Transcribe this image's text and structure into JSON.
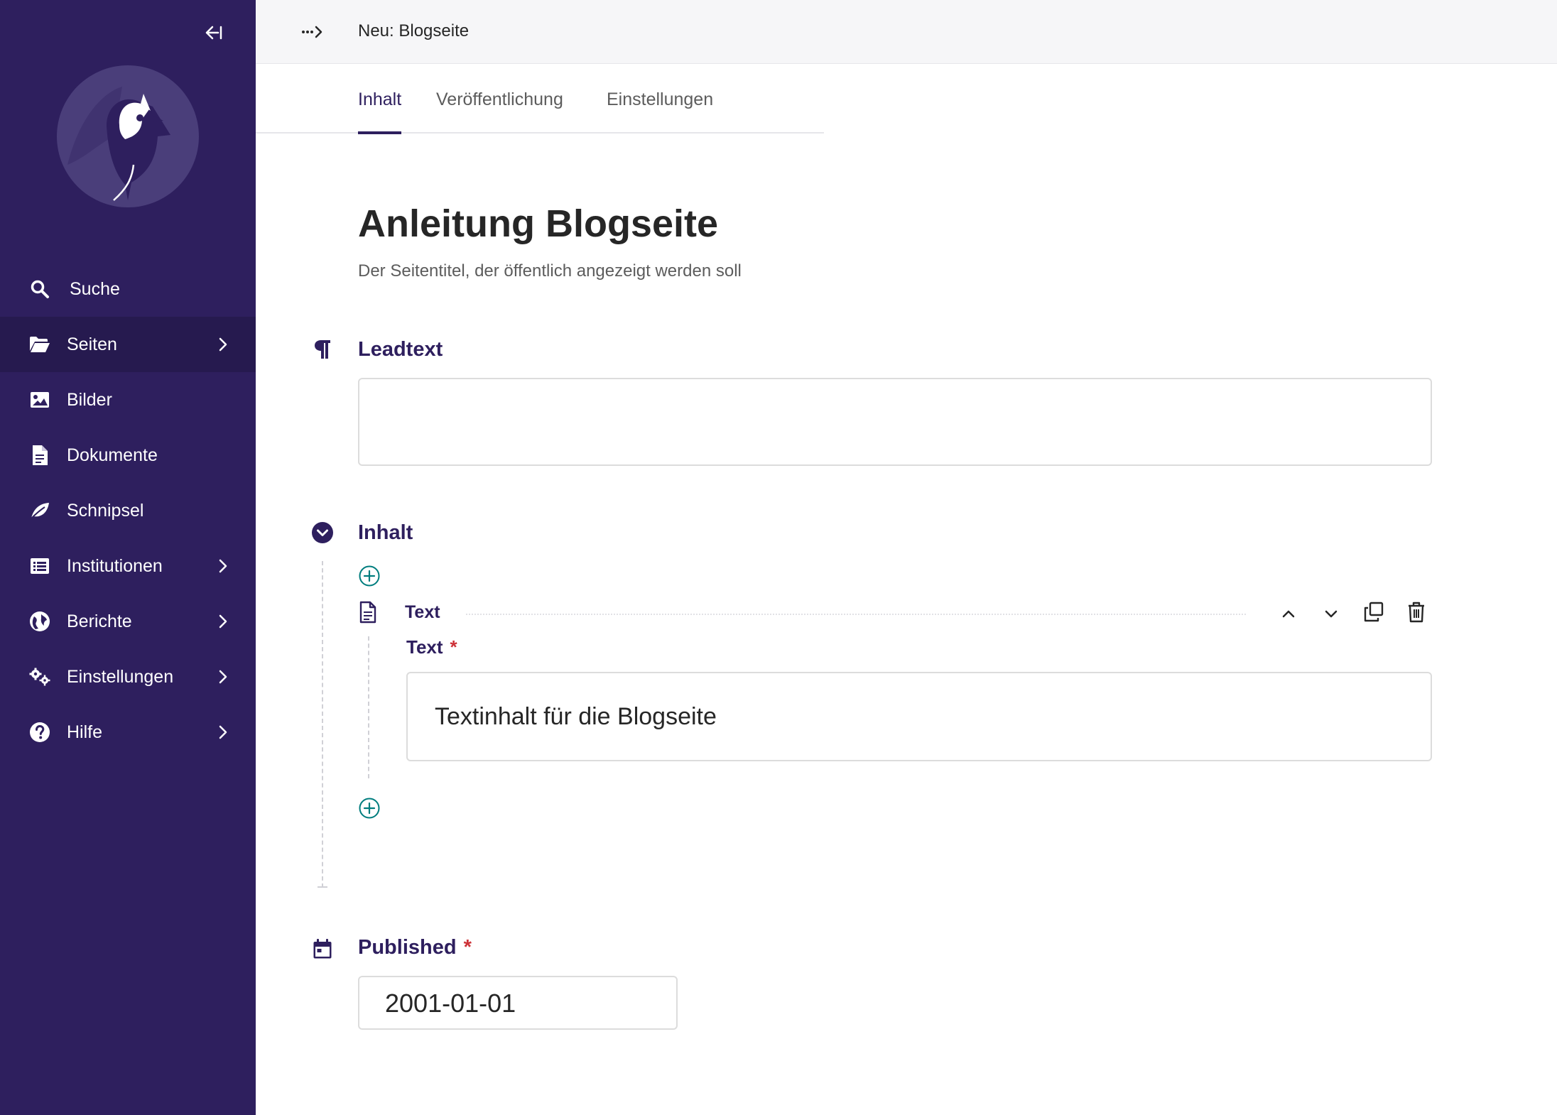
{
  "sidebar": {
    "collapse_label": "←|",
    "items": [
      {
        "label": "Suche",
        "icon": "search-icon",
        "has_submenu": false
      },
      {
        "label": "Seiten",
        "icon": "folder-open-icon",
        "has_submenu": true,
        "active": true
      },
      {
        "label": "Bilder",
        "icon": "image-icon",
        "has_submenu": false
      },
      {
        "label": "Dokumente",
        "icon": "document-icon",
        "has_submenu": false
      },
      {
        "label": "Schnipsel",
        "icon": "snippet-leaf-icon",
        "has_submenu": false
      },
      {
        "label": "Institutionen",
        "icon": "list-icon",
        "has_submenu": true
      },
      {
        "label": "Berichte",
        "icon": "globe-icon",
        "has_submenu": true
      },
      {
        "label": "Einstellungen",
        "icon": "cogs-icon",
        "has_submenu": true
      },
      {
        "label": "Hilfe",
        "icon": "help-icon",
        "has_submenu": true
      }
    ],
    "colors": {
      "background": "#2e1f5e",
      "active": "#261a4f"
    }
  },
  "header": {
    "breadcrumb_title": "Neu: Blogseite"
  },
  "tabs": [
    {
      "label": "Inhalt",
      "active": true
    },
    {
      "label": "Veröffentlichung",
      "active": false
    },
    {
      "label": "Einstellungen",
      "active": false
    }
  ],
  "page": {
    "title": "Anleitung Blogseite",
    "title_help": "Der Seitentitel, der öffentlich angezeigt werden soll"
  },
  "fields": {
    "leadtext": {
      "label": "Leadtext",
      "value": ""
    },
    "inhalt": {
      "label": "Inhalt",
      "block": {
        "title": "Text",
        "field_label": "Text",
        "required_mark": "*",
        "value": "Textinhalt für die Blogseite"
      }
    },
    "published": {
      "label": "Published",
      "required_mark": "*",
      "value": "2001-01-01"
    }
  },
  "colors": {
    "accent": "#2e1f5e",
    "required": "#cd3238",
    "add_button": "#007d7e"
  }
}
